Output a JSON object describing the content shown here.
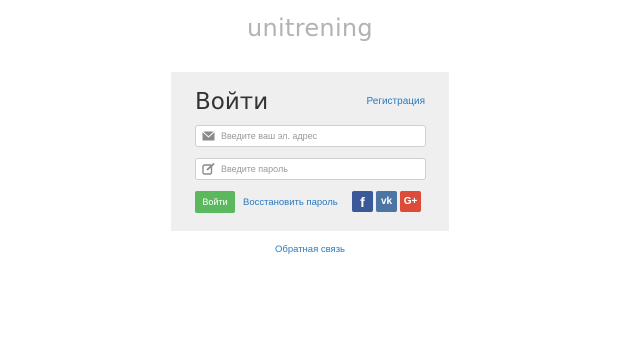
{
  "logo": "unitrening",
  "login": {
    "title": "Войти",
    "register_label": "Регистрация",
    "email_placeholder": "Введите ваш эл. адрес",
    "password_placeholder": "Введите пароль",
    "submit_label": "Войти",
    "restore_label": "Восстановить пароль",
    "social": {
      "facebook": "f",
      "vk": "vk",
      "google": "G+"
    }
  },
  "footer": {
    "feedback_label": "Обратная связь"
  },
  "colors": {
    "accent_link": "#2a7bc0",
    "login_button": "#5cb85c",
    "facebook": "#3b5998",
    "vk": "#4c75a3",
    "google": "#dd4b39"
  }
}
